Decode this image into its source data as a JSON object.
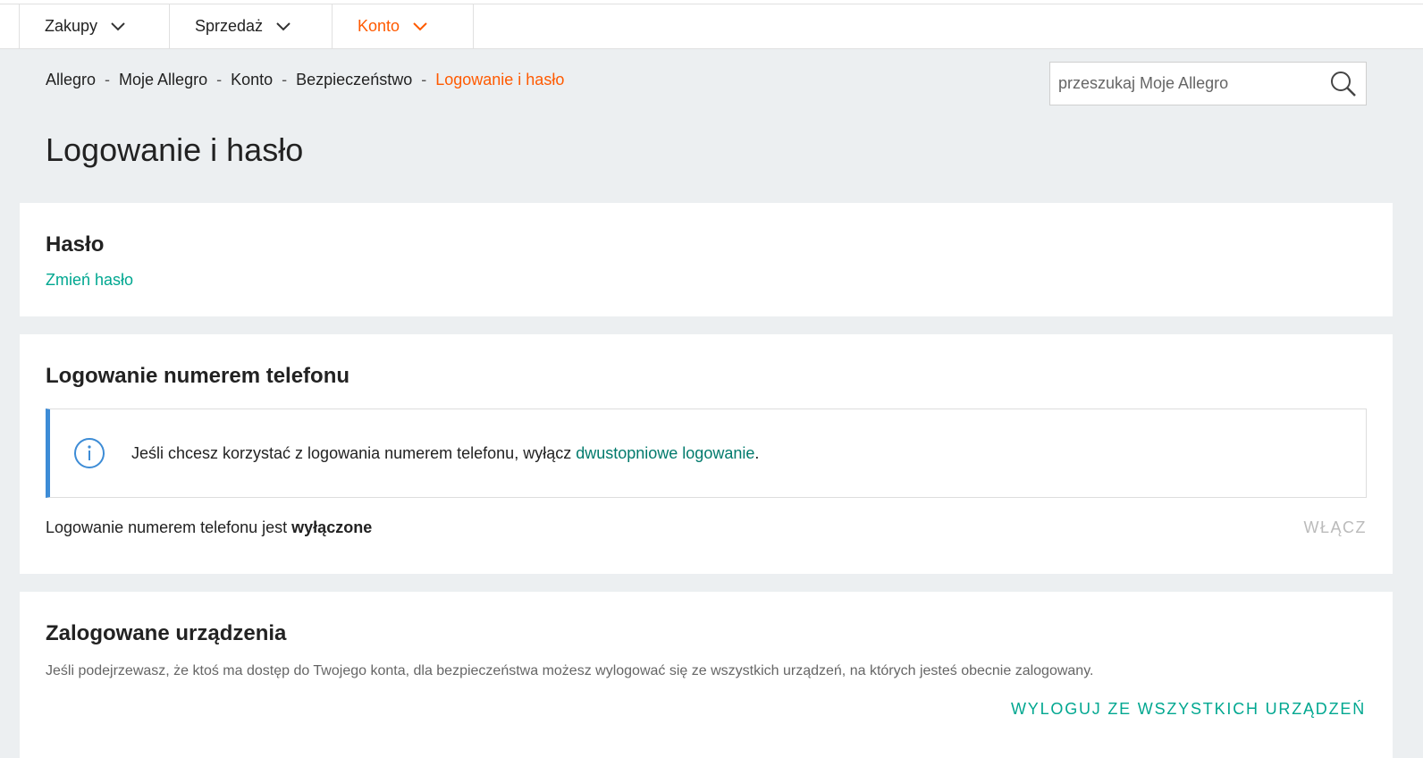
{
  "nav": {
    "items": [
      {
        "label": "Zakupy"
      },
      {
        "label": "Sprzedaż"
      },
      {
        "label": "Konto"
      }
    ]
  },
  "breadcrumb": {
    "items": [
      "Allegro",
      "Moje Allegro",
      "Konto",
      "Bezpieczeństwo"
    ],
    "current": "Logowanie i hasło",
    "separator": "-"
  },
  "search": {
    "placeholder": "przeszukaj Moje Allegro",
    "value": ""
  },
  "page": {
    "title": "Logowanie i hasło"
  },
  "password_section": {
    "title": "Hasło",
    "change_link": "Zmień hasło"
  },
  "phone_login_section": {
    "title": "Logowanie numerem telefonu",
    "info_text_before": "Jeśli chcesz korzystać z logowania numerem telefonu, wyłącz ",
    "info_link": "dwustopniowe logowanie",
    "info_text_after": ".",
    "status_text": "Logowanie numerem telefonu jest ",
    "status_value": "wyłączone",
    "enable_button": "WŁĄCZ"
  },
  "devices_section": {
    "title": "Zalogowane urządzenia",
    "description": "Jeśli podejrzewasz, że ktoś ma dostęp do Twojego konta, dla bezpieczeństwa możesz wylogować się ze wszystkich urządzeń, na których jesteś obecnie zalogowany.",
    "logout_button": "WYLOGUJ ZE WSZYSTKICH URZĄDZEŃ"
  },
  "colors": {
    "accent": "#ff5a00",
    "link": "#00a790",
    "info_border": "#3d8cd6",
    "background": "#eceff1"
  }
}
